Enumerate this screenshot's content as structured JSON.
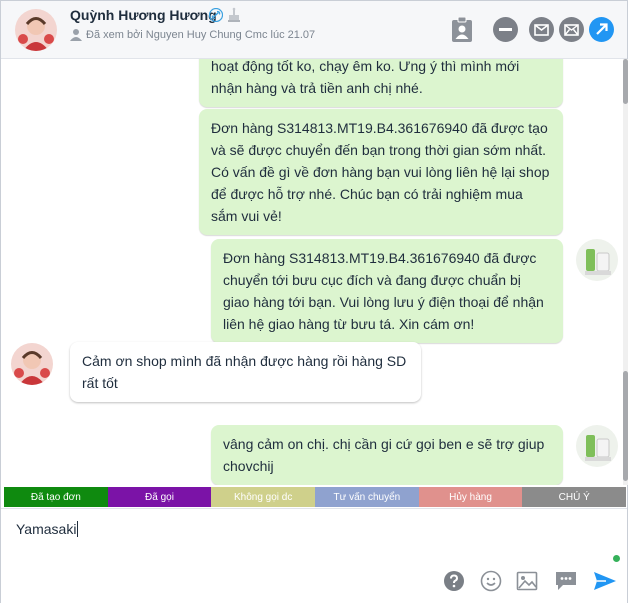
{
  "header": {
    "name": "Quỳnh Hương Hương",
    "seen_text": "Đã xem bởi Nguyen Huy Chung Cmc lúc 21.07"
  },
  "messages": [
    {
      "text": "hoạt động tốt ko, chạy êm ko. Ưng ý thì mình mới nhận hàng và trả tiền anh chị nhé."
    },
    {
      "text": "Đơn hàng S314813.MT19.B4.361676940 đã được tạo và sẽ được chuyển đến bạn trong thời gian sớm nhất. Có vấn đề gì về đơn hàng bạn vui lòng liên hệ lại shop để được hỗ trợ nhé. Chúc bạn có trải nghiệm mua sắm vui vẻ!"
    },
    {
      "text": "Đơn hàng S314813.MT19.B4.361676940 đã được chuyển tới bưu cục đích và đang được chuẩn bị giao hàng tới bạn. Vui lòng lưu ý điện thoại để nhận liên hệ giao hàng từ bưu tá. Xin cám ơn!"
    },
    {
      "text": "Cảm ơn shop mình đã nhận được hàng rồi hàng SD rất tốt"
    },
    {
      "text": "vâng cảm on chị. chị cần gi cứ gọi ben e sẽ trợ giup chovchij"
    }
  ],
  "tags": [
    {
      "label": "Đã tạo đơn",
      "color": "#0f8a0f"
    },
    {
      "label": "Đã gọi",
      "color": "#7b13a7"
    },
    {
      "label": "Không gọi dc",
      "color": "#cfd08b"
    },
    {
      "label": "Tư vấn chuyển",
      "color": "#8fa2cf"
    },
    {
      "label": "Hủy hàng",
      "color": "#e0918d"
    },
    {
      "label": "CHÚ Ý",
      "color": "#8b8b8b"
    }
  ],
  "composer": {
    "text": "Yamasaki"
  }
}
